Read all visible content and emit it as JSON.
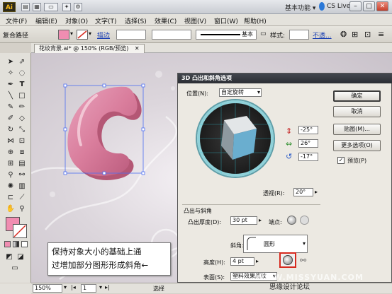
{
  "titlebar": {
    "logo": "Ai",
    "workspace": "基本功能",
    "cslive": "CS Live",
    "minimize": "–",
    "restore": "□",
    "close": "✕"
  },
  "menubar": {
    "items": [
      "文件(F)",
      "编辑(E)",
      "对象(O)",
      "文字(T)",
      "选择(S)",
      "效果(C)",
      "视图(V)",
      "窗口(W)",
      "帮助(H)"
    ]
  },
  "controlbar": {
    "selection_label": "复合路径",
    "stroke_label": "描边",
    "stroke_style": "基本",
    "style_label": "样式:",
    "opacity_label": "不透..."
  },
  "doctab": {
    "title": "花纹背景.ai* @ 150% (RGB/预览)",
    "close": "✕"
  },
  "statusbar": {
    "zoom": "150%",
    "page": "1",
    "info": "选择"
  },
  "dialog": {
    "title": "3D 凸出和斜角选项",
    "position_label": "位置(N):",
    "position_value": "自定旋转",
    "rotation_x": "-25°",
    "rotation_y": "26°",
    "rotation_z": "-17°",
    "perspective_label": "透视(R):",
    "perspective_value": "20°",
    "extrude_section": "凸出与斜角",
    "extrude_depth_label": "凸出厚度(D):",
    "extrude_depth_value": "30 pt",
    "cap_label": "端点:",
    "bevel_label": "斜角:",
    "bevel_value": "圆形",
    "height_label": "高度(H):",
    "height_value": "4 pt",
    "surface_label": "表面(S):",
    "surface_value": "塑料效果底纹",
    "ok": "确定",
    "cancel": "取消",
    "map_art": "贴图(M)...",
    "more_options": "更多选项(O)",
    "preview_label": "预览(P)",
    "preview_checked": true
  },
  "callout": {
    "line1": "保持对象大小的基础上通",
    "line2": "过增加部分图形形成斜角"
  },
  "watermark": "WWW.MISSYUAN.COM",
  "credit": "思缘设计论坛",
  "colors": {
    "fill": "#f08db1",
    "shape": "#d97d9c",
    "cube_face": "#6aaecf",
    "highlight": "#d62a1f"
  }
}
